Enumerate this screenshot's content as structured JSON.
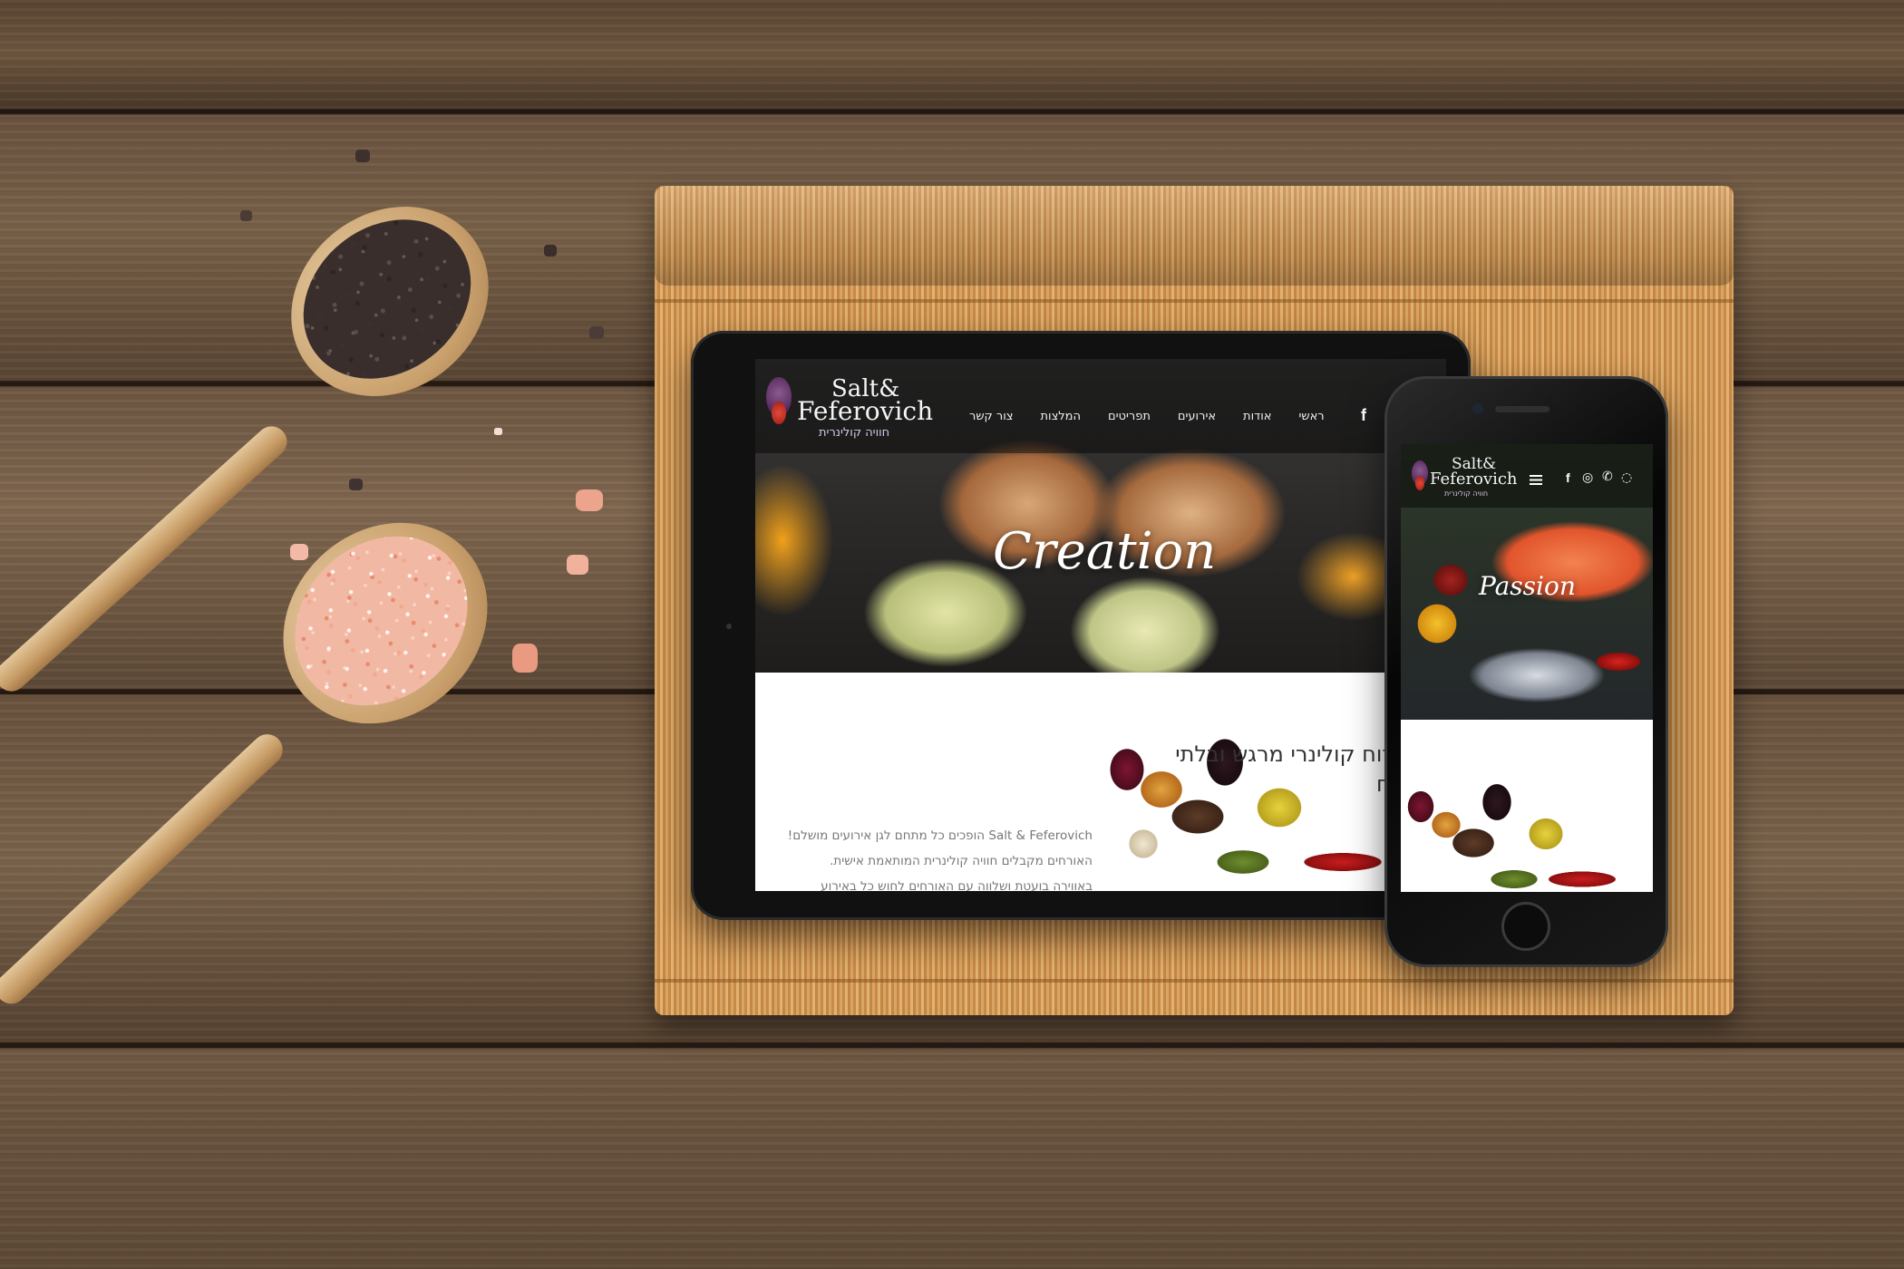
{
  "brand": {
    "name_line1": "Salt&",
    "name_line2": "Feferovich",
    "tagline": "חוויה קולינרית"
  },
  "nav": {
    "items": [
      "ראשי",
      "אודות",
      "אירועים",
      "תפריטים",
      "המלצות",
      "צור קשר"
    ]
  },
  "tablet": {
    "hero_script": "Creation",
    "headline": "לאירוח קולינרי מרגש ובלתי נשכח",
    "paragraph_lines": [
      "Salt & Feferovich הופכים כל מתחם לגן אירועים מושלם!",
      "האורחים מקבלים חוויה קולינרית המותאמת אישית.",
      "באווירה בועטת ושלווה עם האורחים לחוש כל באירוע"
    ]
  },
  "phone": {
    "hero_script": "Passion"
  },
  "icons": {
    "facebook": "f",
    "instagram": "◎",
    "phone": "✆",
    "whatsapp": "◌",
    "menu": "hamburger-icon"
  }
}
